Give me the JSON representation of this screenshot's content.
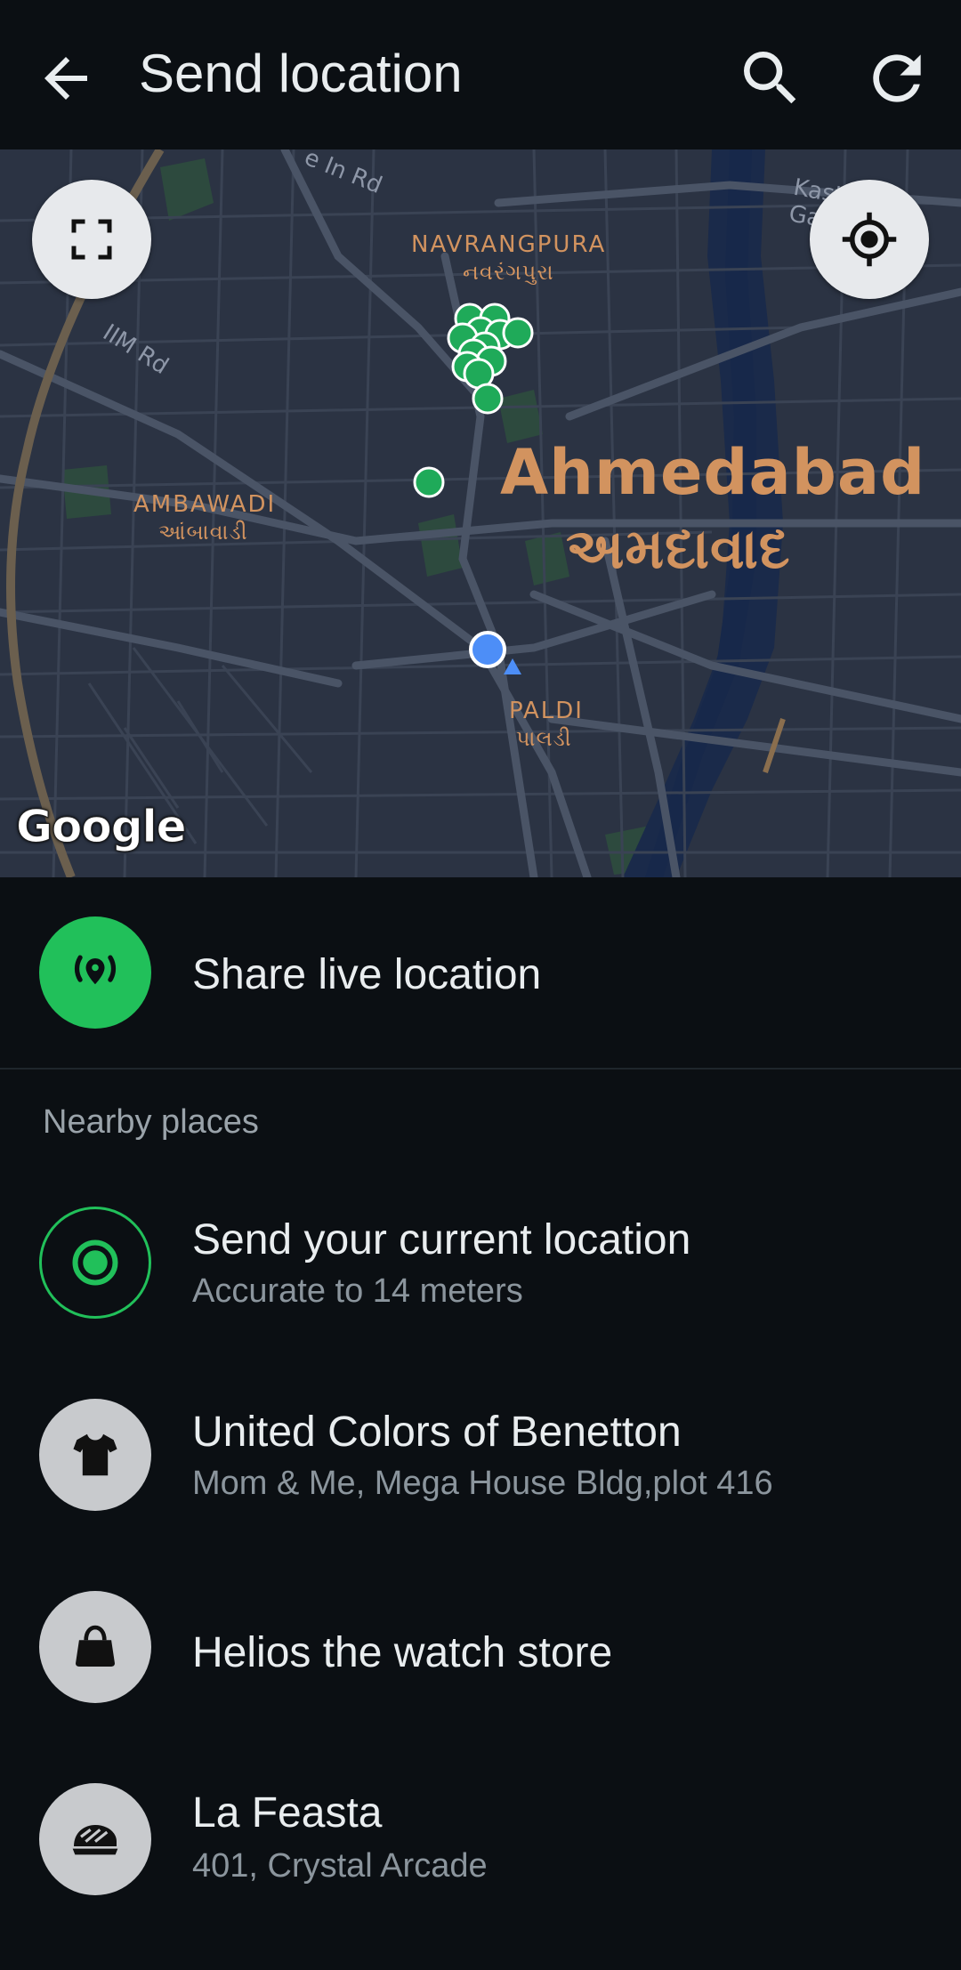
{
  "appbar": {
    "title": "Send location",
    "back_icon": "arrow-left-icon",
    "search_icon": "search-icon",
    "refresh_icon": "refresh-icon"
  },
  "map": {
    "labels": {
      "navrangpura_en": "NAVRANGPURA",
      "navrangpura_gu": "નવરંગપુરા",
      "ambawadi_en": "AMBAWADI",
      "ambawadi_gu": "આંબાવાડી",
      "ahmedabad_en": "Ahmedabad",
      "ahmedabad_gu": "અમદાવાદ",
      "paldi_en": "PALDI",
      "paldi_gu": "પાલડી",
      "iim_rd": "IIM Rd",
      "top_rd": "e In Rd",
      "kasturba": "Kasturba Gand"
    },
    "attribution": "Google",
    "expand_icon": "fullscreen-icon",
    "locate_icon": "my-location-icon"
  },
  "live": {
    "label": "Share live location",
    "icon": "live-location-icon",
    "accent": "#25d366"
  },
  "nearby": {
    "section_label": "Nearby places",
    "current": {
      "title": "Send your current location",
      "subtitle": "Accurate to 14 meters",
      "icon": "current-location-icon"
    },
    "places": [
      {
        "title": "United Colors of Benetton",
        "subtitle": "Mom & Me, Mega House Bldg,plot 416",
        "icon": "tshirt-icon"
      },
      {
        "title": "Helios the watch store",
        "subtitle": "",
        "icon": "handbag-icon"
      },
      {
        "title": "La Feasta",
        "subtitle": "401, Crystal Arcade",
        "icon": "food-icon"
      }
    ]
  }
}
